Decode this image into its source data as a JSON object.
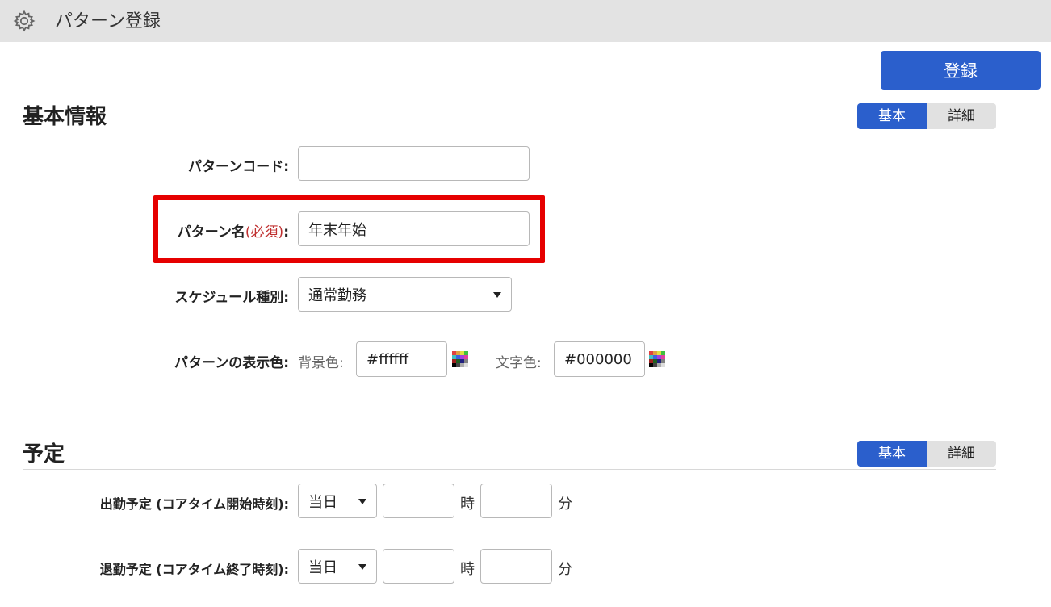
{
  "header": {
    "title": "パターン登録",
    "icon": "gear-icon"
  },
  "toolbar": {
    "register_label": "登録",
    "accent": "#2b5fcc"
  },
  "basic_section": {
    "title": "基本情報",
    "toggle": {
      "basic_label": "基本",
      "detail_label": "詳細"
    },
    "pattern_code": {
      "label": "パターンコード:",
      "value": ""
    },
    "pattern_name": {
      "label": "パターン名",
      "required": "(必須)",
      "colon": ":",
      "value": "年末年始"
    },
    "schedule_type": {
      "label": "スケジュール種別:",
      "value": "通常勤務"
    },
    "display_color": {
      "label": "パターンの表示色:",
      "bg_label": "背景色:",
      "bg_value": "#ffffff",
      "text_label": "文字色:",
      "text_value": "#000000"
    }
  },
  "schedule_section": {
    "title": "予定",
    "toggle": {
      "basic_label": "基本",
      "detail_label": "詳細"
    },
    "start": {
      "label": "出勤予定 (コアタイム開始時刻):",
      "day": "当日",
      "hour": "",
      "minute": "",
      "hour_unit": "時",
      "minute_unit": "分"
    },
    "end": {
      "label": "退勤予定 (コアタイム終了時刻):",
      "day": "当日",
      "hour": "",
      "minute": "",
      "hour_unit": "時",
      "minute_unit": "分"
    }
  },
  "highlight_color": "#e60000"
}
